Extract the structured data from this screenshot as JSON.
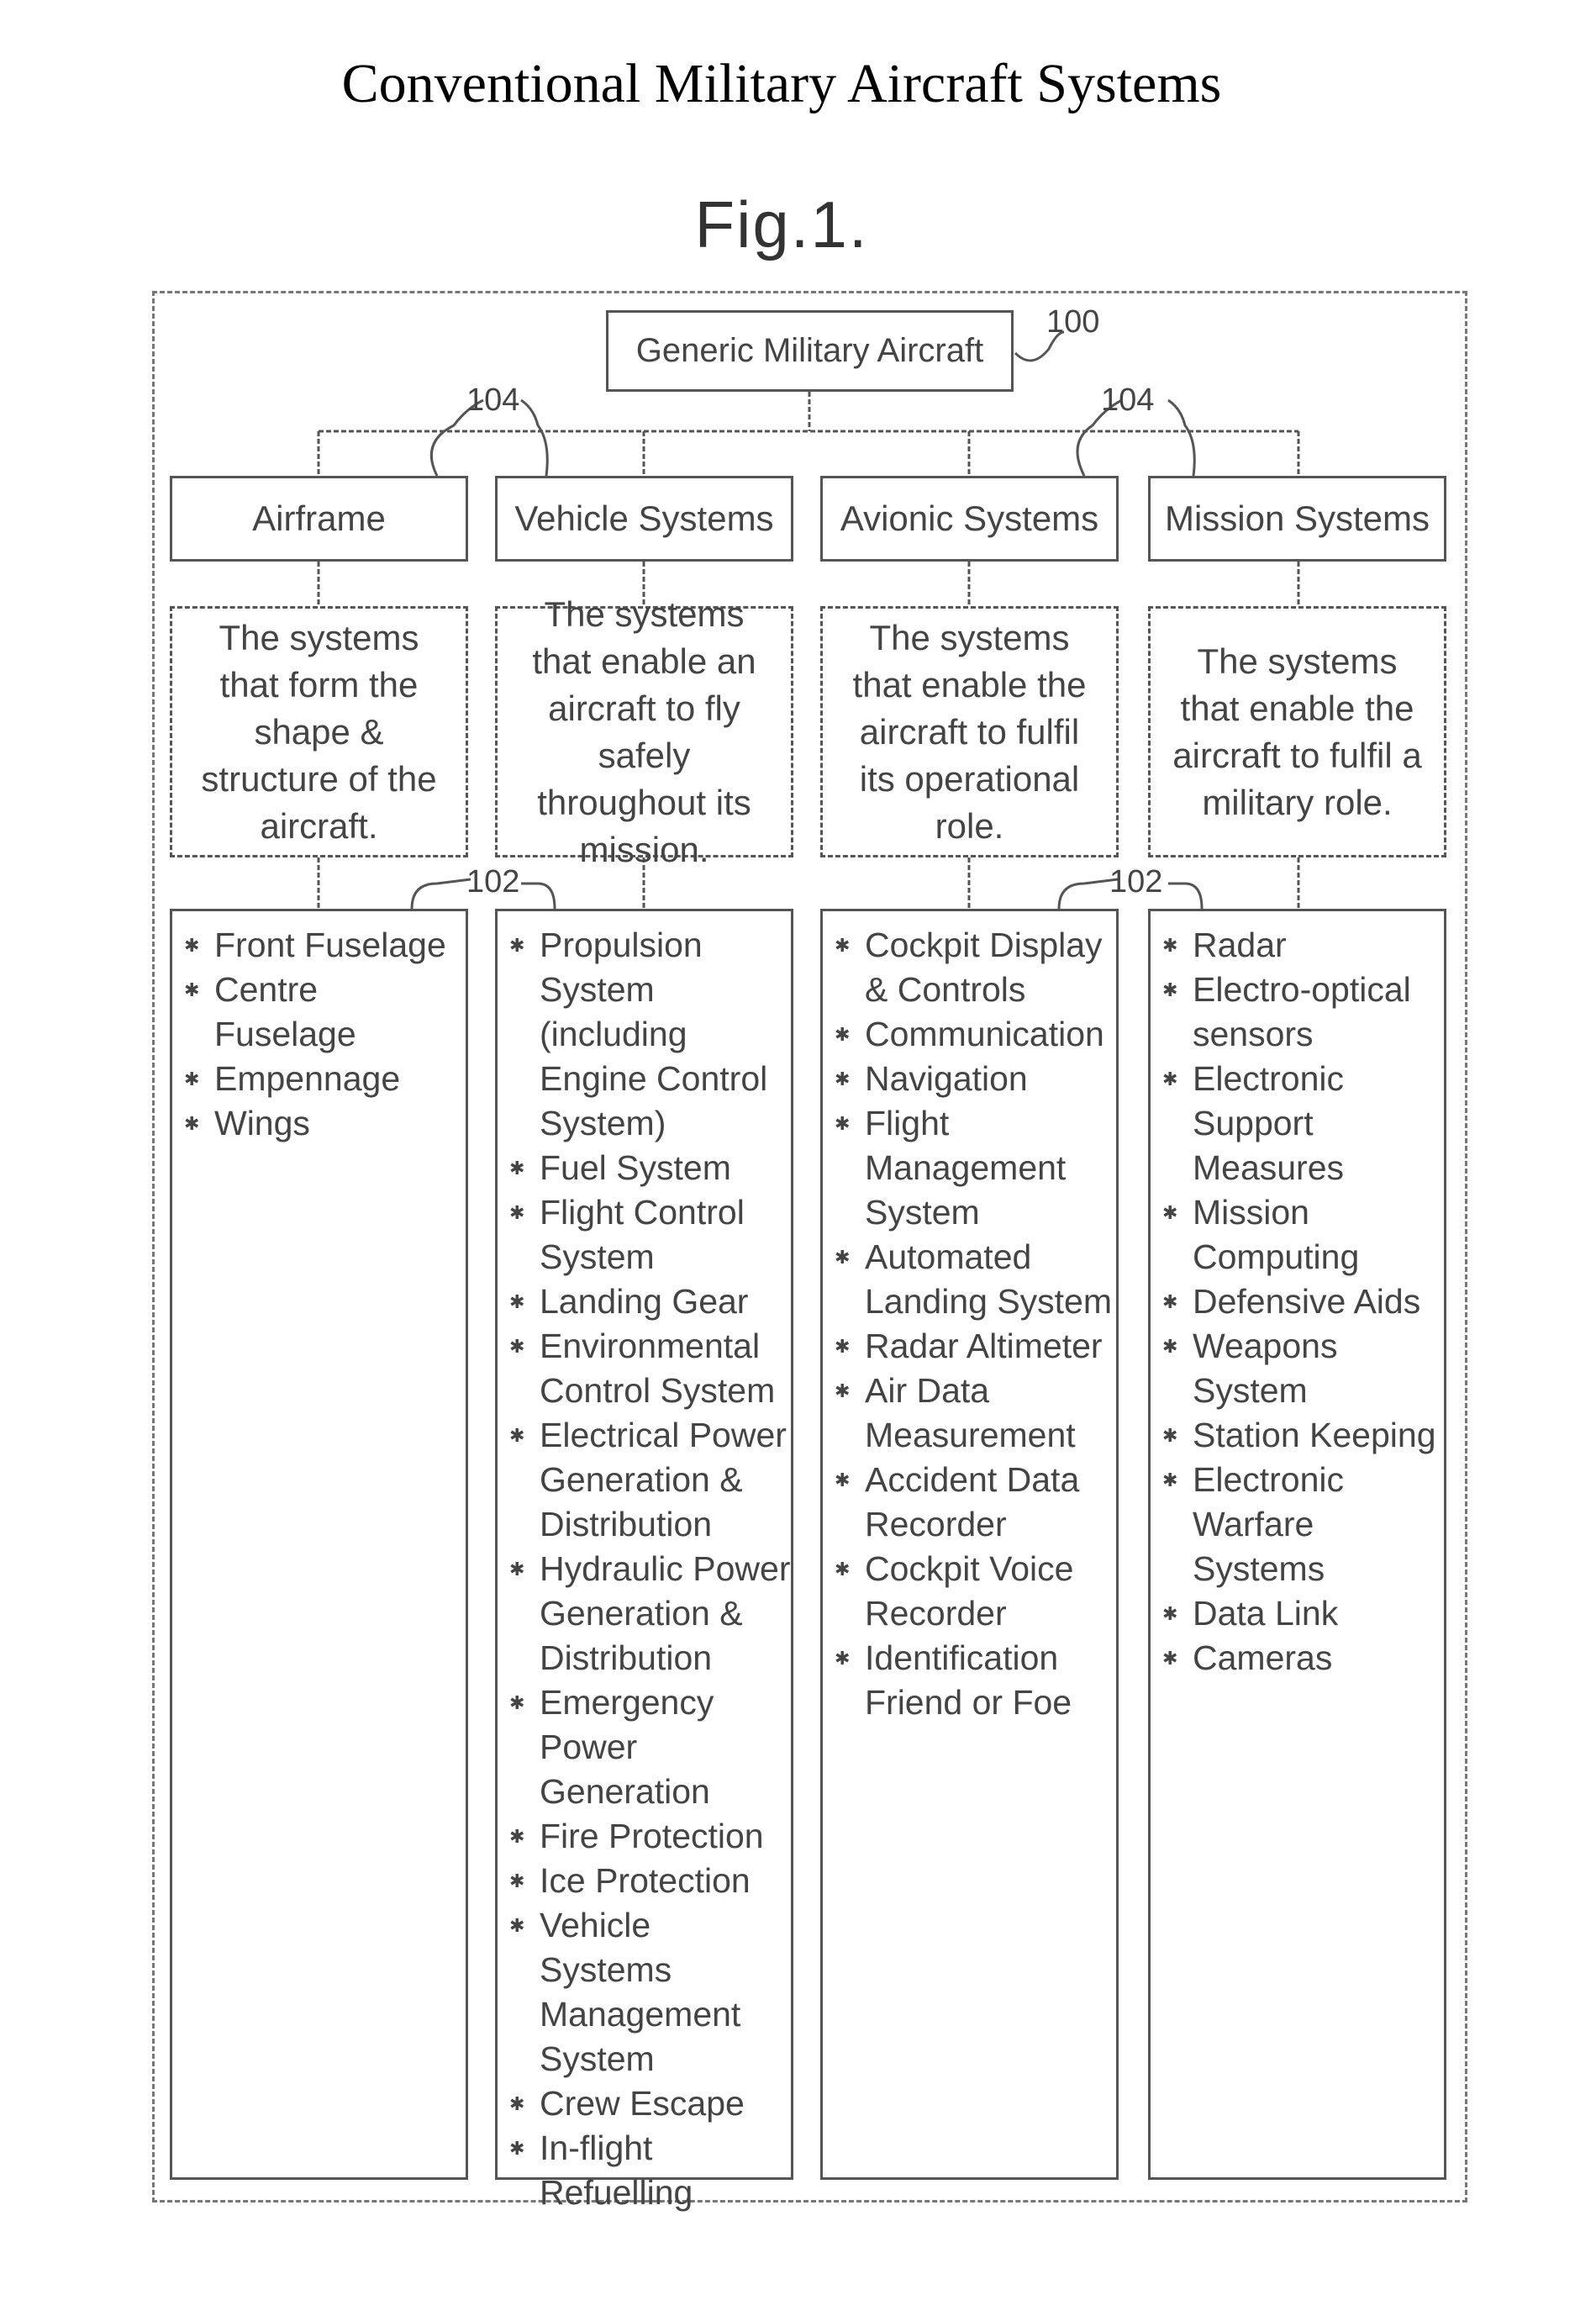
{
  "page_title": "Conventional Military Aircraft Systems",
  "figure_label": "Fig.1.",
  "root": {
    "label": "Generic Military Aircraft",
    "ref": "100"
  },
  "refs": {
    "level": "104",
    "list": "102"
  },
  "columns": [
    {
      "category": "Airframe",
      "description": "The systems that form the shape & structure of the aircraft.",
      "items": [
        "Front Fuselage",
        "Centre Fuselage",
        "Empennage",
        "Wings"
      ]
    },
    {
      "category": "Vehicle Systems",
      "description": "The systems that enable an aircraft to fly safely throughout its mission.",
      "items": [
        "Propulsion System (including Engine Control System)",
        "Fuel System",
        "Flight Control System",
        "Landing Gear",
        "Environmental Control System",
        "Electrical Power Generation & Distribution",
        "Hydraulic Power Generation & Distribution",
        "Emergency Power Generation",
        "Fire Protection",
        "Ice Protection",
        "Vehicle Systems Management System",
        "Crew Escape",
        "In-flight Refuelling"
      ]
    },
    {
      "category": "Avionic Systems",
      "description": "The systems that enable the aircraft to fulfil its operational role.",
      "items": [
        "Cockpit Display & Controls",
        "Communication",
        "Navigation",
        "Flight Management System",
        "Automated Landing System",
        "Radar Altimeter",
        "Air Data Measurement",
        "Accident Data Recorder",
        "Cockpit Voice Recorder",
        "Identification Friend or Foe"
      ]
    },
    {
      "category": "Mission Systems",
      "description": "The systems that enable the aircraft to fulfil a military role.",
      "items": [
        "Radar",
        "Electro-optical sensors",
        "Electronic Support Measures",
        "Mission Computing",
        "Defensive Aids",
        "Weapons System",
        "Station Keeping",
        "Electronic Warfare Systems",
        "Data Link",
        "Cameras"
      ]
    }
  ]
}
